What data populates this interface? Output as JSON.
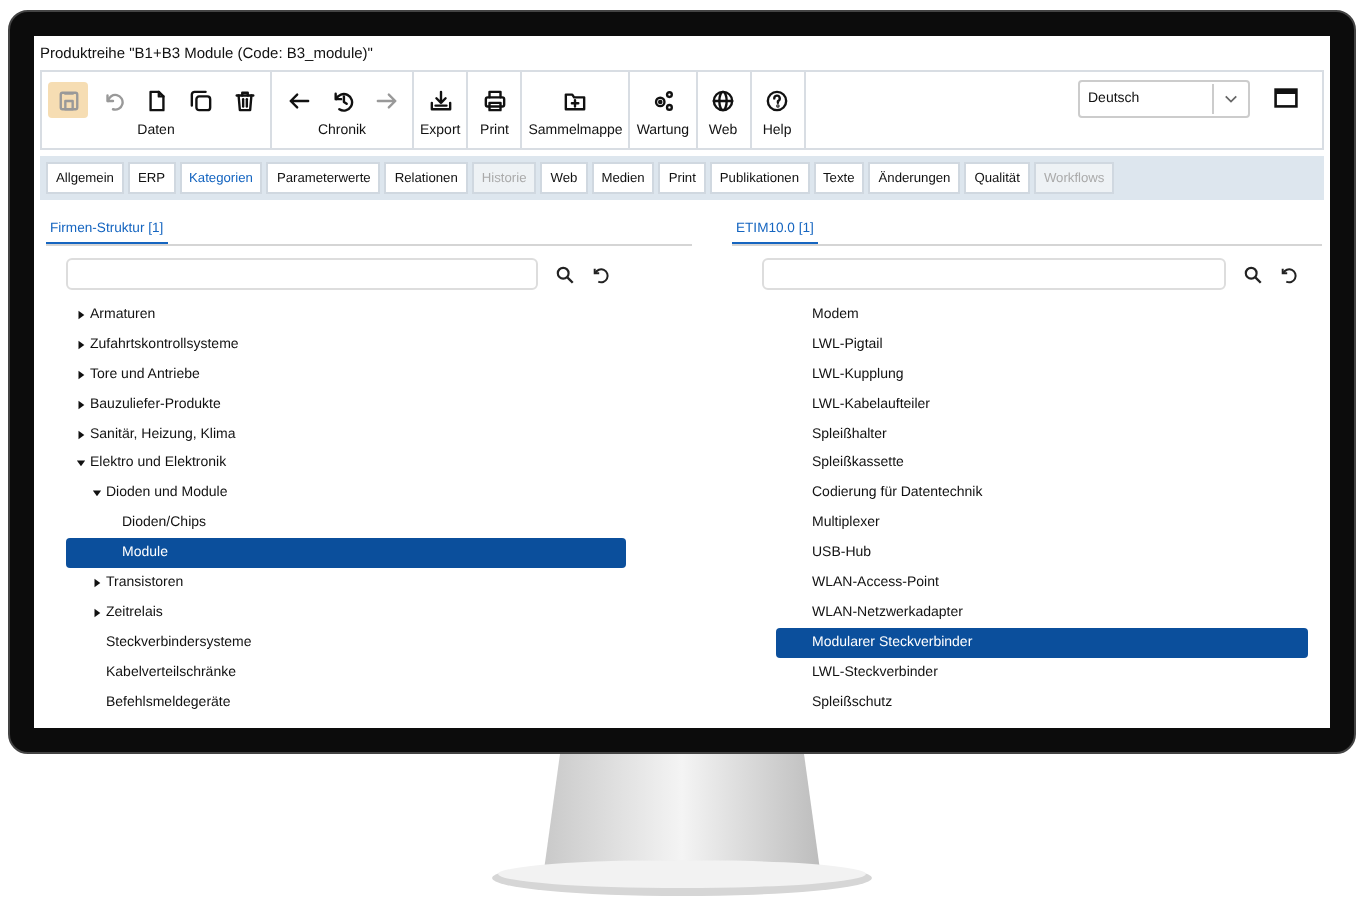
{
  "window": {
    "title": "Produktreihe \"B1+B3 Module (Code: B3_module)\""
  },
  "toolbar": [
    {
      "label": "Daten",
      "buttons": [
        {
          "kind": "save",
          "disabled": true,
          "highlighted": true
        },
        {
          "kind": "undo",
          "disabled": true,
          "highlighted": false
        },
        {
          "kind": "new",
          "disabled": false,
          "highlighted": false
        },
        {
          "kind": "copy",
          "disabled": false,
          "highlighted": false
        },
        {
          "kind": "delete",
          "disabled": false,
          "highlighted": false
        }
      ]
    },
    {
      "label": "Chronik",
      "buttons": [
        {
          "kind": "back",
          "disabled": false,
          "highlighted": false
        },
        {
          "kind": "history",
          "disabled": false,
          "highlighted": false
        },
        {
          "kind": "forward",
          "disabled": true,
          "highlighted": false
        }
      ]
    },
    {
      "label": "Export",
      "buttons": [
        {
          "kind": "export",
          "disabled": false,
          "highlighted": false
        }
      ]
    },
    {
      "label": "Print",
      "buttons": [
        {
          "kind": "print",
          "disabled": false,
          "highlighted": false
        }
      ]
    },
    {
      "label": "Sammelmappe",
      "buttons": [
        {
          "kind": "folder",
          "disabled": false,
          "highlighted": false
        }
      ]
    },
    {
      "label": "Wartung",
      "buttons": [
        {
          "kind": "gear",
          "disabled": false,
          "highlighted": false
        }
      ]
    },
    {
      "label": "Web",
      "buttons": [
        {
          "kind": "globe",
          "disabled": false,
          "highlighted": false
        }
      ]
    },
    {
      "label": "Help",
      "buttons": [
        {
          "kind": "help",
          "disabled": false,
          "highlighted": false
        }
      ]
    }
  ],
  "language": {
    "value": "Deutsch"
  },
  "tabs": [
    {
      "label": "Allgemein",
      "selected": false,
      "disabled": false
    },
    {
      "label": "ERP",
      "selected": false,
      "disabled": false
    },
    {
      "label": "Kategorien",
      "selected": true,
      "disabled": false
    },
    {
      "label": "Parameterwerte",
      "selected": false,
      "disabled": false
    },
    {
      "label": "Relationen",
      "selected": false,
      "disabled": false
    },
    {
      "label": "Historie",
      "selected": false,
      "disabled": true
    },
    {
      "label": "Web",
      "selected": false,
      "disabled": false
    },
    {
      "label": "Medien",
      "selected": false,
      "disabled": false
    },
    {
      "label": "Print",
      "selected": false,
      "disabled": false
    },
    {
      "label": "Publikationen",
      "selected": false,
      "disabled": false
    },
    {
      "label": "Texte",
      "selected": false,
      "disabled": false
    },
    {
      "label": "Änderungen",
      "selected": false,
      "disabled": false
    },
    {
      "label": "Qualität",
      "selected": false,
      "disabled": false
    },
    {
      "label": "Workflows",
      "selected": false,
      "disabled": true
    }
  ],
  "left_panel": {
    "heading": "Firmen-Struktur [1]",
    "tree": [
      {
        "label": "Armaturen",
        "kind": "folder",
        "expanded": false,
        "selected": false
      },
      {
        "label": "Zufahrtskontrollsysteme",
        "kind": "folder",
        "expanded": false,
        "selected": false
      },
      {
        "label": "Tore und Antriebe",
        "kind": "folder",
        "expanded": false,
        "selected": false
      },
      {
        "label": "Bauzuliefer-Produkte",
        "kind": "folder",
        "expanded": false,
        "selected": false
      },
      {
        "label": "Sanitär, Heizung, Klima",
        "kind": "folder",
        "expanded": false,
        "selected": false
      },
      {
        "label": "Elektro und Elektronik",
        "kind": "folder",
        "expanded": true,
        "selected": false,
        "children": [
          {
            "label": "Dioden und Module",
            "kind": "folder",
            "expanded": true,
            "selected": false,
            "children": [
              {
                "label": "Dioden/Chips",
                "kind": "leaf",
                "selected": false
              },
              {
                "label": "Module",
                "kind": "leaf",
                "selected": true
              }
            ]
          },
          {
            "label": "Transistoren",
            "kind": "folder",
            "expanded": false,
            "selected": false
          },
          {
            "label": "Zeitrelais",
            "kind": "folder",
            "expanded": false,
            "selected": false
          },
          {
            "label": "Steckverbindersysteme",
            "kind": "leaf",
            "selected": false
          },
          {
            "label": "Kabelverteilschränke",
            "kind": "leaf",
            "selected": false
          },
          {
            "label": "Befehlsmeldegeräte",
            "kind": "leaf",
            "selected": false
          }
        ]
      }
    ]
  },
  "right_panel": {
    "heading": "ETIM10.0 [1]",
    "items": [
      {
        "label": "Modem",
        "selected": false
      },
      {
        "label": "LWL-Pigtail",
        "selected": false
      },
      {
        "label": "LWL-Kupplung",
        "selected": false
      },
      {
        "label": "LWL-Kabelaufteiler",
        "selected": false
      },
      {
        "label": "Spleißhalter",
        "selected": false
      },
      {
        "label": "Spleißkassette",
        "selected": false
      },
      {
        "label": "Codierung für Datentechnik",
        "selected": false
      },
      {
        "label": "Multiplexer",
        "selected": false
      },
      {
        "label": "USB-Hub",
        "selected": false
      },
      {
        "label": "WLAN-Access-Point",
        "selected": false
      },
      {
        "label": "WLAN-Netzwerkadapter",
        "selected": false
      },
      {
        "label": "Modularer Steckverbinder",
        "selected": true
      },
      {
        "label": "LWL-Steckverbinder",
        "selected": false
      },
      {
        "label": "Spleißschutz",
        "selected": false
      }
    ]
  }
}
